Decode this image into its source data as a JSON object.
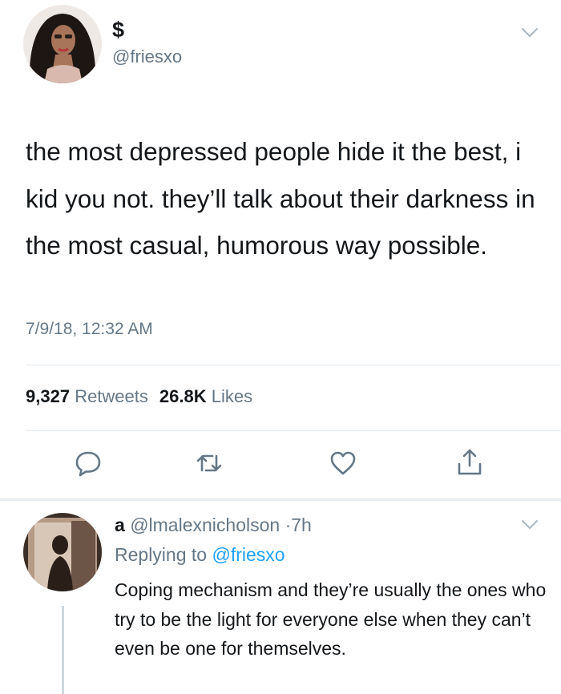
{
  "tweet": {
    "display_name": "$",
    "handle": "@friesxo",
    "text": "the most depressed people hide it the best, i kid you not. they’ll talk about their darkness in the most casual, humorous way possible.",
    "timestamp": "7/9/18, 12:32 AM",
    "stats": {
      "retweets_count": "9,327",
      "retweets_label": "Retweets",
      "likes_count": "26.8K",
      "likes_label": "Likes"
    }
  },
  "actions": [
    "reply-icon",
    "retweet-icon",
    "heart-icon",
    "share-icon"
  ],
  "reply": {
    "display_name": "a",
    "handle": "@lmalexnicholson",
    "separator": "·",
    "time": "7h",
    "replying_label": "Replying to",
    "replying_handle": "@friesxo",
    "text": "Coping mechanism and they’re usually the ones who try to be the light for everyone else when they can’t even be one for themselves."
  },
  "colors": {
    "text": "#14171a",
    "secondary": "#657786",
    "link": "#1da1f2",
    "divider": "#e1e8ed"
  }
}
